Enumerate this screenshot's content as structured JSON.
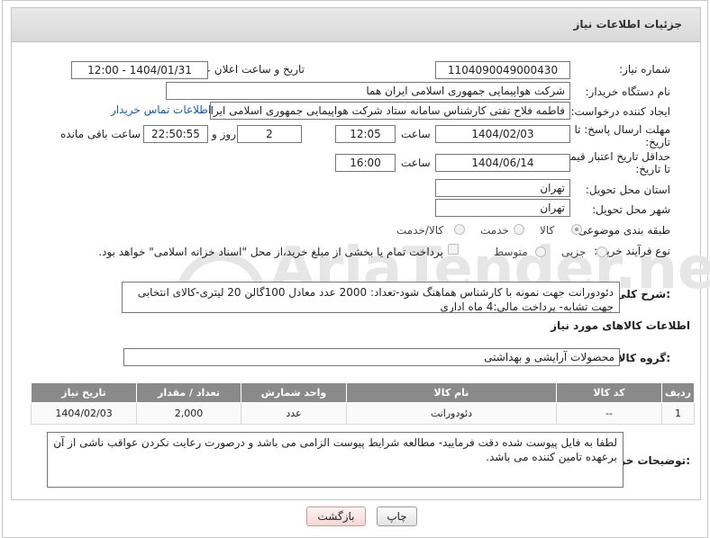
{
  "header": {
    "title": "جزئیات اطلاعات نیاز"
  },
  "form": {
    "need_number_label": "شماره نیاز:",
    "need_number": "1104090049000430",
    "announce_label": "تاریخ و ساعت اعلان عمومی:",
    "announce_value": "1404/01/31 - 12:00",
    "buyer_org_label": "نام دستگاه خریدار:",
    "buyer_org": "شرکت هواپیمایی جمهوری اسلامی ایران هما",
    "creator_label": "ایجاد کننده درخواست:",
    "creator": "فاطمه فلاح تفتی کارشناس سامانه ستاد شرکت هواپیمایی جمهوری اسلامی ایران",
    "buyer_contact_link": "اطلاعات تماس خریدار",
    "deadline_label_1": "مهلت ارسال پاسخ: تا",
    "deadline_label_2": "تاریخ:",
    "deadline_date": "1404/02/03",
    "time_label": "ساعت",
    "deadline_time": "12:05",
    "days_value": "2",
    "days_label": "روز و",
    "remaining_time": "22:50:55",
    "remaining_label": "ساعت باقی مانده",
    "min_valid_label_1": "حداقل تاریخ اعتبار قیمت:",
    "min_valid_label_2": "تا تاریخ:",
    "min_valid_date": "1404/06/14",
    "min_valid_time_label": "ساعت",
    "min_valid_time": "16:00",
    "province_label": "استان محل تحویل:",
    "province": "تهران",
    "city_label": "شهر محل تحویل:",
    "city": "تهران",
    "category_label": "طبقه بندی موضوعی:",
    "category_options": [
      "کالا",
      "خدمت",
      "کالا/خدمت"
    ],
    "category_selected": "کالا",
    "process_label": "نوع فرآیند خرید :",
    "process_options": [
      "جزیی",
      "متوسط"
    ],
    "process_selected": "جزیی",
    "payment_note": "پرداخت تمام یا بخشی از مبلغ خرید،از محل \"اسناد خزانه اسلامی\" خواهد بود."
  },
  "description": {
    "label": "شرح کلی نیاز:",
    "text": "دئودورانت جهت نمونه با کارشناس هماهنگ شود-تعداد: 2000 عدد معادل 100گالن 20 لیتری-کالای انتخابی جهت تشابه- پرداخت مالی:4 ماه اداری"
  },
  "goods": {
    "section_title": "اطلاعات کالاهای مورد نیاز",
    "group_label": "گروه کالا:",
    "group_value": "محصولات آرایشی و بهداشتی",
    "columns": [
      "ردیف",
      "کد کالا",
      "نام کالا",
      "واحد شمارش",
      "تعداد / مقدار",
      "تاریخ نیاز"
    ],
    "rows": [
      [
        "1",
        "--",
        "دئودورانت",
        "عدد",
        "2,000",
        "1404/02/03"
      ]
    ]
  },
  "buyer_notes": {
    "label": "توضیحات خریدار:",
    "text": "لطفا به فایل پیوست شده دقت فرمایید- مطالعه شرایط پیوست الزامی می باشد و درصورت رعایت نکردن عواقب ناشی از آن برعهده تامین کننده می باشد."
  },
  "buttons": {
    "print": "چاپ",
    "back": "بازگشت"
  },
  "watermark": {
    "text": "AriaTender.neT"
  },
  "colors": {
    "link": "#1a5aa6",
    "table_header": "#8a8a8a",
    "watermark": "#e6e6e6"
  }
}
